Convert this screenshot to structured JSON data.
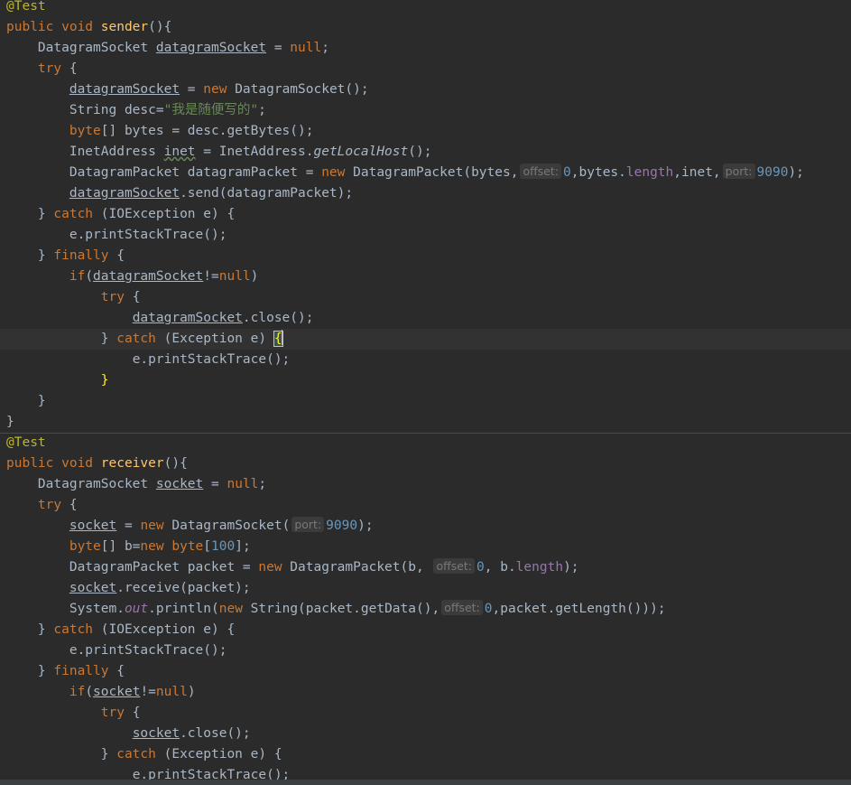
{
  "editor": {
    "language": "java",
    "annotation": "@Test",
    "sender": {
      "header_kw": "public void ",
      "name": "sender",
      "decl_type": "DatagramSocket ",
      "var": "datagramSocket",
      "assign_null": " = ",
      "null_kw": "null",
      "string_type": "String desc=",
      "string_value": "\"我是随便写的\"",
      "bytes_line": "[] bytes = desc.getBytes();",
      "inet_decl": "InetAddress ",
      "inet_var": "inet",
      "inet_rhs": " = InetAddress.",
      "getLocalHost": "getLocalHost",
      "packet_decl": "DatagramPacket datagramPacket = ",
      "packet_ctor": " DatagramPacket(bytes,",
      "hint_offset": "offset:",
      "offset_val": "0",
      "bytes_length_prefix": ",bytes.",
      "length_field": "length",
      "inet_arg": ",inet,",
      "hint_port": "port:",
      "port_val": "9090",
      "send_call": ".send(datagramPacket);",
      "ioexception": " (IOException e) {",
      "print_stack": "e.printStackTrace();",
      "close_call": ".close();",
      "exception": " (Exception e) "
    },
    "receiver": {
      "header_kw": "public void ",
      "name": "receiver",
      "decl_type": "DatagramSocket ",
      "var": "socket",
      "ctor": " DatagramSocket(",
      "buf_line_type": "[] b=",
      "buf_size": "100",
      "packet_decl": "DatagramPacket packet = ",
      "packet_ctor": " DatagramPacket(b, ",
      "b_length_prefix": ", b.",
      "receive_call": ".receive(packet);",
      "system": "System.",
      "out": "out",
      "println": ".println(",
      "string_ctor": " String(packet.getData(),",
      "get_length": ",packet.getLength()));"
    },
    "keywords": {
      "try": "try",
      "catch": "catch",
      "finally": "finally",
      "if": "if",
      "new": "new",
      "byte": "byte",
      "neq_null": "!=",
      "close_paren": ")"
    },
    "colors": {
      "background": "#2b2b2b",
      "keyword": "#cc7832",
      "method_name": "#ffc66d",
      "string": "#6a8759",
      "number": "#6897bb",
      "field": "#9876aa",
      "annotation": "#bbb529",
      "default_text": "#a9b7c6"
    }
  }
}
